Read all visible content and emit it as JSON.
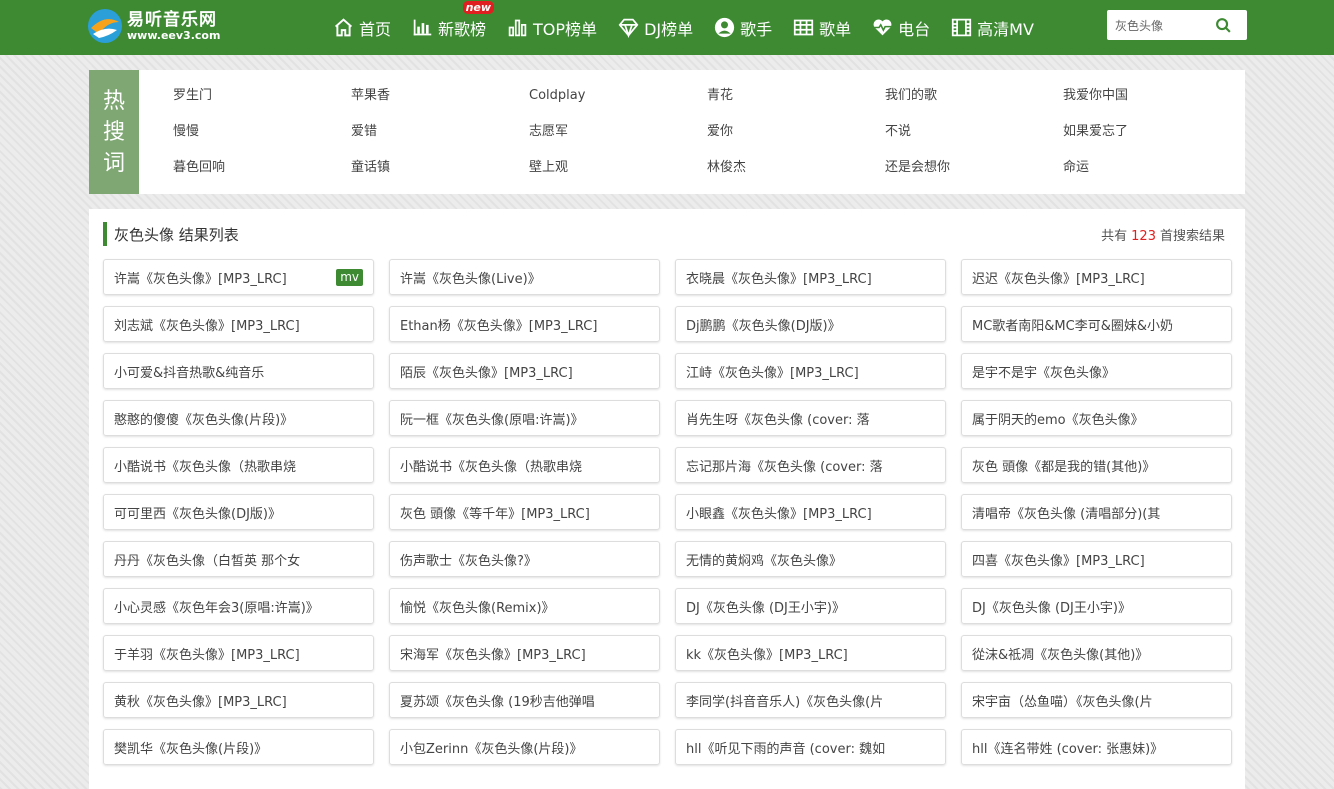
{
  "header": {
    "logo_cn": "易听音乐网",
    "logo_url": "www.eev3.com",
    "nav": [
      {
        "label": "首页",
        "icon": "home-icon"
      },
      {
        "label": "新歌榜",
        "icon": "bar-chart-icon",
        "badge": "new"
      },
      {
        "label": "TOP榜单",
        "icon": "bar-chart-icon"
      },
      {
        "label": "DJ榜单",
        "icon": "diamond-icon"
      },
      {
        "label": "歌手",
        "icon": "user-icon"
      },
      {
        "label": "歌单",
        "icon": "grid-icon"
      },
      {
        "label": "电台",
        "icon": "heartbeat-icon"
      },
      {
        "label": "高清MV",
        "icon": "film-icon"
      }
    ],
    "search_value": "灰色头像",
    "search_icon": "search-icon"
  },
  "hot": {
    "label": [
      "热",
      "搜",
      "词"
    ],
    "words": [
      "罗生门",
      "苹果香",
      "Coldplay",
      "青花",
      "我们的歌",
      "我爱你中国",
      "慢慢",
      "爱错",
      "志愿军",
      "爱你",
      "不说",
      "如果爱忘了",
      "暮色回响",
      "童话镇",
      "壁上观",
      "林俊杰",
      "还是会想你",
      "命运"
    ]
  },
  "results": {
    "title": "灰色头像 结果列表",
    "count_prefix": "共有",
    "count": "123",
    "count_suffix": "首搜索结果",
    "mv_label": "mv",
    "colors": {
      "accent": "#3d8a33",
      "count": "#e02020"
    },
    "songs": [
      {
        "title": "许嵩《灰色头像》[MP3_LRC]",
        "mv": true
      },
      {
        "title": "许嵩《灰色头像(Live)》"
      },
      {
        "title": "衣晓晨《灰色头像》[MP3_LRC]"
      },
      {
        "title": "迟迟《灰色头像》[MP3_LRC]"
      },
      {
        "title": "刘志斌《灰色头像》[MP3_LRC]"
      },
      {
        "title": "Ethan杨《灰色头像》[MP3_LRC]"
      },
      {
        "title": "Dj鹏鹏《灰色头像(DJ版)》"
      },
      {
        "title": "MC歌者南阳&MC李可&圈妹&小奶"
      },
      {
        "title": "小可爱&抖音热歌&纯音乐"
      },
      {
        "title": "陌辰《灰色头像》[MP3_LRC]"
      },
      {
        "title": "江峙《灰色头像》[MP3_LRC]"
      },
      {
        "title": "是宇不是宇《灰色头像》"
      },
      {
        "title": "憨憨的傻傻《灰色头像(片段)》"
      },
      {
        "title": "阮一框《灰色头像(原唱:许嵩)》"
      },
      {
        "title": "肖先生呀《灰色头像 (cover: 落"
      },
      {
        "title": "属于阴天的emo《灰色头像》"
      },
      {
        "title": "小酷说书《灰色头像（热歌串烧"
      },
      {
        "title": "小酷说书《灰色头像（热歌串烧"
      },
      {
        "title": "忘记那片海《灰色头像 (cover: 落"
      },
      {
        "title": "灰色 頭像《都是我的错(其他)》"
      },
      {
        "title": "可可里西《灰色头像(DJ版)》"
      },
      {
        "title": "灰色 頭像《等千年》[MP3_LRC]"
      },
      {
        "title": "小眼鑫《灰色头像》[MP3_LRC]"
      },
      {
        "title": "清唱帝《灰色头像 (清唱部分)(其"
      },
      {
        "title": "丹丹《灰色头像（白皙英 那个女"
      },
      {
        "title": "伤声歌士《灰色头像?》"
      },
      {
        "title": "无情的黄焖鸡《灰色头像》"
      },
      {
        "title": "四喜《灰色头像》[MP3_LRC]"
      },
      {
        "title": "小心灵感《灰色年会3(原唱:许嵩)》"
      },
      {
        "title": "愉悦《灰色头像(Remix)》"
      },
      {
        "title": "DJ《灰色头像 (DJ王小宇)》"
      },
      {
        "title": "DJ《灰色头像 (DJ王小宇)》"
      },
      {
        "title": "于羊羽《灰色头像》[MP3_LRC]"
      },
      {
        "title": "宋海军《灰色头像》[MP3_LRC]"
      },
      {
        "title": "kk《灰色头像》[MP3_LRC]"
      },
      {
        "title": "從沫&祗凋《灰色头像(其他)》"
      },
      {
        "title": "黄秋《灰色头像》[MP3_LRC]"
      },
      {
        "title": "夏苏颂《灰色头像 (19秒吉他弹唱"
      },
      {
        "title": "李同学(抖音音乐人)《灰色头像(片"
      },
      {
        "title": "宋宇亩（怂鱼喵）《灰色头像(片"
      },
      {
        "title": "樊凯华《灰色头像(片段)》"
      },
      {
        "title": "小包Zerinn《灰色头像(片段)》"
      },
      {
        "title": "hll《听见下雨的声音 (cover: 魏如"
      },
      {
        "title": "hll《连名带姓 (cover: 张惠妹)》"
      }
    ]
  }
}
